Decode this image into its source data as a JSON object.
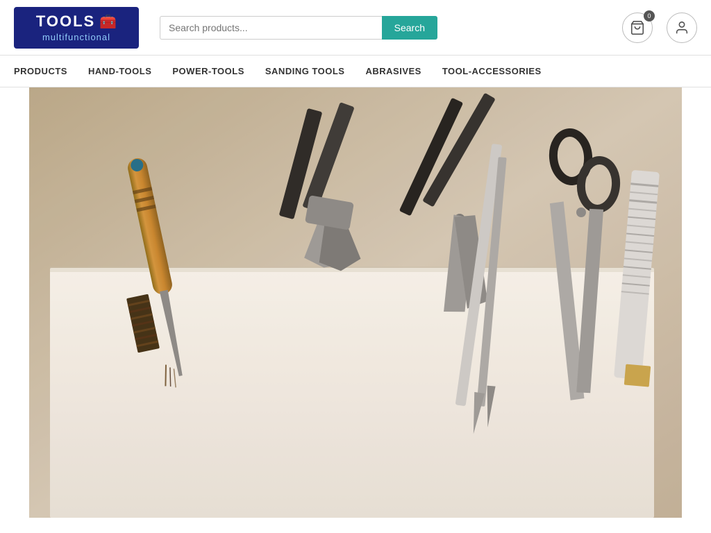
{
  "logo": {
    "title": "TOOLS",
    "subtitle": "multifunctional",
    "icon": "🧰"
  },
  "search": {
    "placeholder": "Search products...",
    "button_label": "Search"
  },
  "cart": {
    "badge": "0"
  },
  "nav": {
    "items": [
      {
        "label": "PRODUCTS",
        "id": "products"
      },
      {
        "label": "HAND-TOOLS",
        "id": "hand-tools"
      },
      {
        "label": "POWER-TOOLS",
        "id": "power-tools"
      },
      {
        "label": "SANDING TOOLS",
        "id": "sanding-tools"
      },
      {
        "label": "ABRASIVES",
        "id": "abrasives"
      },
      {
        "label": "TOOL-ACCESSORIES",
        "id": "tool-accessories"
      }
    ]
  },
  "hero": {
    "alt": "Various hand tools laid out on a white surface"
  }
}
